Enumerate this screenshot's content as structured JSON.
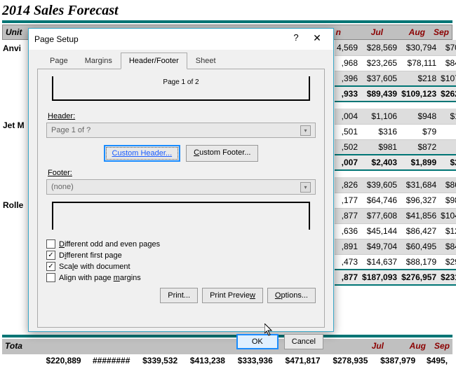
{
  "page_title": "2014 Sales Forecast",
  "header_row": {
    "unit": "Unit",
    "month_n": "n",
    "jul": "Jul",
    "aug": "Aug",
    "sep": "Sep"
  },
  "row_labels": {
    "anvil": "Anvi",
    "jetm": "Jet M",
    "rolle": "Rolle"
  },
  "grid": {
    "r1": [
      "4,569",
      "$28,569",
      "$30,794",
      "$70,"
    ],
    "r2": [
      ",968",
      "$23,265",
      "$78,111",
      "$84,"
    ],
    "r3": [
      ",396",
      "$37,605",
      "$218",
      "$107,"
    ],
    "r4": [
      ",933",
      "$89,439",
      "$109,123",
      "$262,"
    ],
    "r5": [
      ",004",
      "$1,106",
      "$948",
      "$1,"
    ],
    "r6": [
      ",501",
      "$316",
      "$79",
      "$"
    ],
    "r7": [
      ",502",
      "$981",
      "$872",
      "$"
    ],
    "r8": [
      ",007",
      "$2,403",
      "$1,899",
      "$2,"
    ],
    "r9": [
      ",826",
      "$39,605",
      "$31,684",
      "$86,"
    ],
    "r10": [
      ",177",
      "$64,746",
      "$96,327",
      "$98,"
    ],
    "r11": [
      ",877",
      "$77,608",
      "$41,856",
      "$104,"
    ],
    "r12": [
      ",636",
      "$45,144",
      "$86,427",
      "$12,"
    ],
    "r13": [
      ",891",
      "$49,704",
      "$60,495",
      "$84,"
    ],
    "r14": [
      ",473",
      "$14,637",
      "$88,179",
      "$29,"
    ],
    "r15": [
      ",877",
      "$187,093",
      "$276,957",
      "$231,"
    ]
  },
  "totals_row": {
    "label": "Tota",
    "jul": "Jul",
    "aug": "Aug",
    "sep": "Sep"
  },
  "totals_vals": [
    "$220,889",
    "########",
    "$339,532",
    "$413,238",
    "$333,936",
    "$471,817",
    "$278,935",
    "$387,979",
    "$495,"
  ],
  "dialog": {
    "title": "Page Setup",
    "tabs": {
      "page": "Page",
      "margins": "Margins",
      "hf": "Header/Footer",
      "sheet": "Sheet"
    },
    "preview_text": "Page 1 of 2",
    "header_label": "Header:",
    "header_combo": "Page 1 of ?",
    "custom_header": "Custom Header...",
    "custom_footer": "Custom Footer...",
    "footer_label": "Footer:",
    "footer_combo": "(none)",
    "chk1": "Different odd and even pages",
    "chk2": "Different first page",
    "chk3": "Scale with document",
    "chk4": "Align with page margins",
    "print": "Print...",
    "preview": "Print Preview",
    "options": "Options...",
    "ok": "OK",
    "cancel": "Cancel"
  }
}
